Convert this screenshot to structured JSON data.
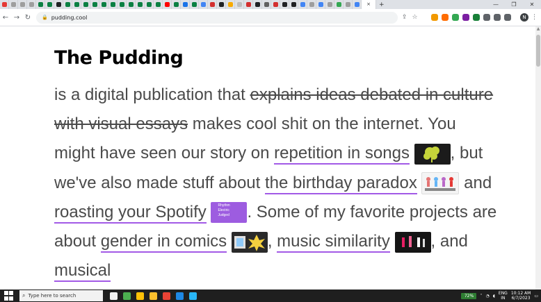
{
  "browser": {
    "tab_favicon_colors": [
      "#e53935",
      "#9e9e9e",
      "#9e9e9e",
      "#9e9e9e",
      "#0b8043",
      "#0b8043",
      "#202124",
      "#0b8043",
      "#0b8043",
      "#0b8043",
      "#0b8043",
      "#0b8043",
      "#0b8043",
      "#0b8043",
      "#0b8043",
      "#0b8043",
      "#0b8043",
      "#0b8043",
      "#ff0000",
      "#0b8043",
      "#1a73e8",
      "#0b8043",
      "#4285f4",
      "#d32f2f",
      "#202124",
      "#f9ab00",
      "#bdbdbd",
      "#d32f2f",
      "#202124",
      "#616161",
      "#d32f2f",
      "#202124",
      "#202124",
      "#4285f4",
      "#9e9e9e",
      "#4285f4",
      "#9e9e9e",
      "#34a853",
      "#9e9e9e",
      "#4285f4"
    ],
    "active_tab_close": "×",
    "new_tab": "+",
    "window_controls": [
      "—",
      "❐",
      "✕"
    ],
    "nav": {
      "back": "←",
      "forward": "→",
      "reload": "↻"
    },
    "url": "pudding.cool",
    "profile_initial": "N",
    "extension_colors": [
      "#f29900",
      "#ff6d00",
      "#34a853",
      "#7b1fa2",
      "#188038",
      "#5f6368",
      "#5f6368",
      "#5f6368"
    ]
  },
  "page": {
    "title": "The Pudding",
    "intro": "is a digital publication that ",
    "struck": "explains ideas debated in culture with visual essays",
    "after_struck": " makes cool shit on the internet. You might have seen our story on ",
    "link_repetition": "repetition in songs",
    "t1": ", but we've also made stuff about ",
    "link_birthday": "the birthday paradox",
    "t2": " and ",
    "link_spotify": "roasting your Spotify",
    "t3": ". Some of my favorite projects are about ",
    "link_gender": "gender in comics",
    "t4": ", ",
    "link_music": "music similarity",
    "t5": ", and ",
    "link_musical": "musical",
    "spotify_thumb_lines": [
      "Rhythm",
      "Electric",
      "Judged"
    ]
  },
  "taskbar": {
    "search_placeholder": "Type here to search",
    "battery": "72%",
    "lang": "ENG",
    "region": "IN",
    "time": "10:12 AM",
    "date": "6/7/2023",
    "app_colors": [
      "#f0f0f0",
      "#4caf50",
      "#ffc107",
      "#fbc02d",
      "#ea4335",
      "#1e88e5",
      "#29b6f6"
    ]
  },
  "colors": {
    "link_underline": "#a259e6",
    "text": "#4a4a4a"
  }
}
